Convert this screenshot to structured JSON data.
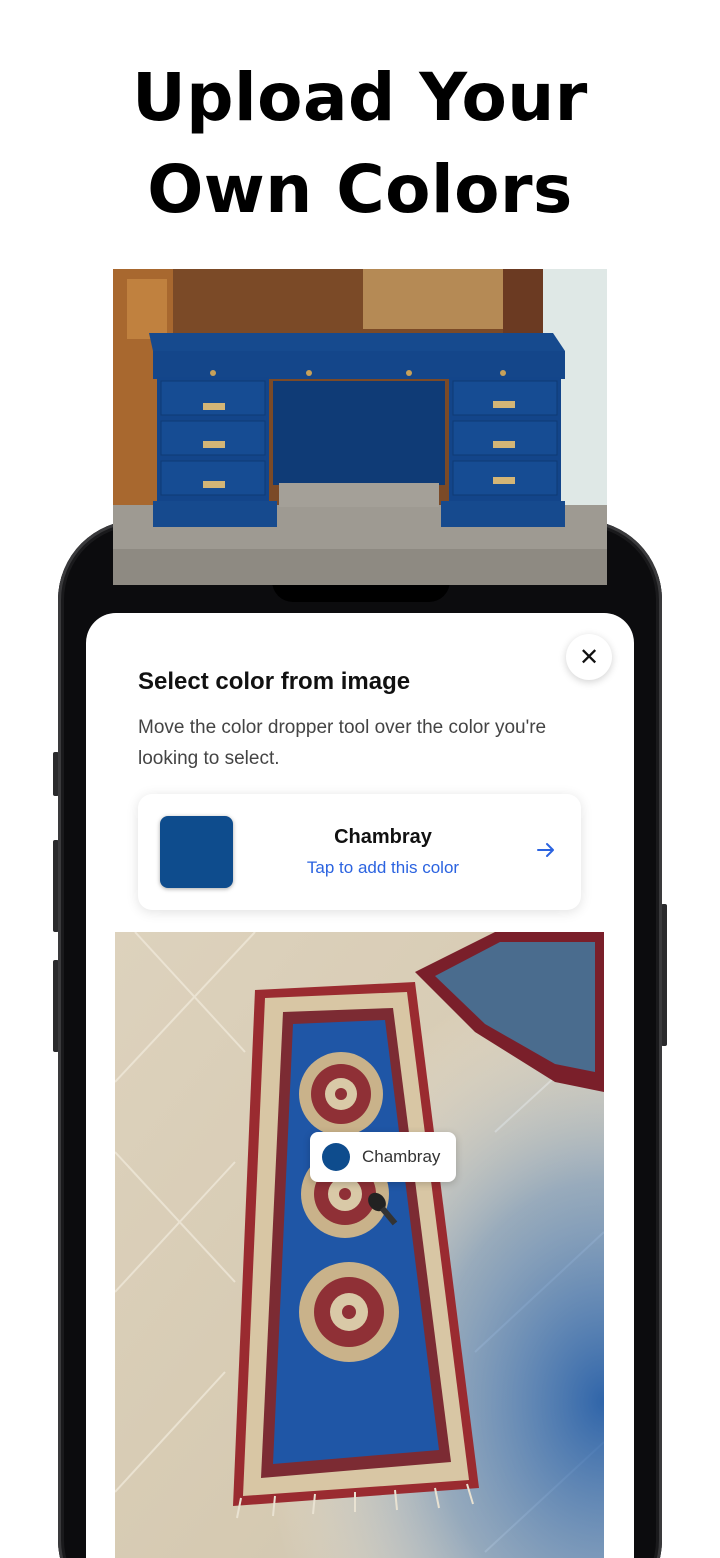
{
  "headline": {
    "line1": "Upload Your",
    "line2": "Own Colors"
  },
  "sheet": {
    "title": "Select color from image",
    "description": "Move the color dropper tool over the color you're looking to select.",
    "close_icon": "close-icon"
  },
  "color_card": {
    "name": "Chambray",
    "action": "Tap to add this color",
    "swatch_color": "#0e4c8d",
    "arrow_icon": "arrow-right-icon"
  },
  "dropper": {
    "label": "Chambray",
    "color": "#0e4c8d"
  },
  "colors": {
    "accent": "#2b63e0",
    "selected": "#0e4c8d"
  }
}
